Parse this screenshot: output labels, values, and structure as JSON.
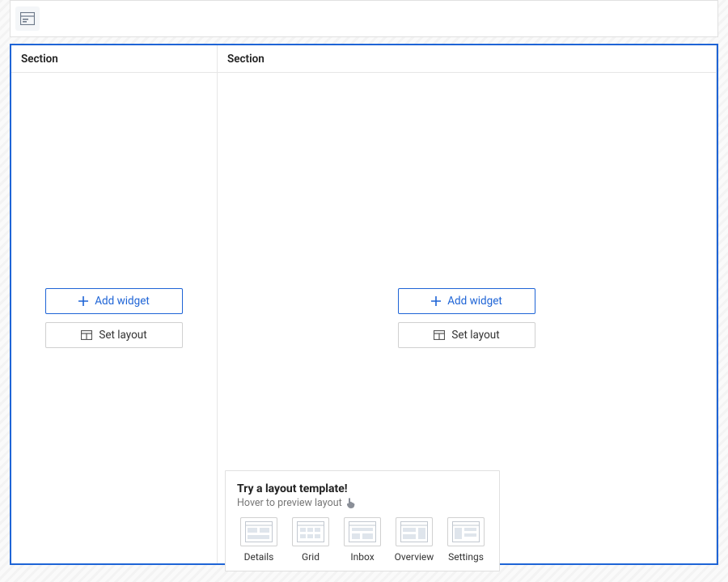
{
  "sections": {
    "left": {
      "title": "Section"
    },
    "right": {
      "title": "Section"
    }
  },
  "buttons": {
    "add_widget": "Add widget",
    "set_layout": "Set layout"
  },
  "panel": {
    "title": "Try a layout template!",
    "subtitle": "Hover to preview layout",
    "templates": [
      {
        "label": "Details"
      },
      {
        "label": "Grid"
      },
      {
        "label": "Inbox"
      },
      {
        "label": "Overview"
      },
      {
        "label": "Settings"
      }
    ]
  }
}
